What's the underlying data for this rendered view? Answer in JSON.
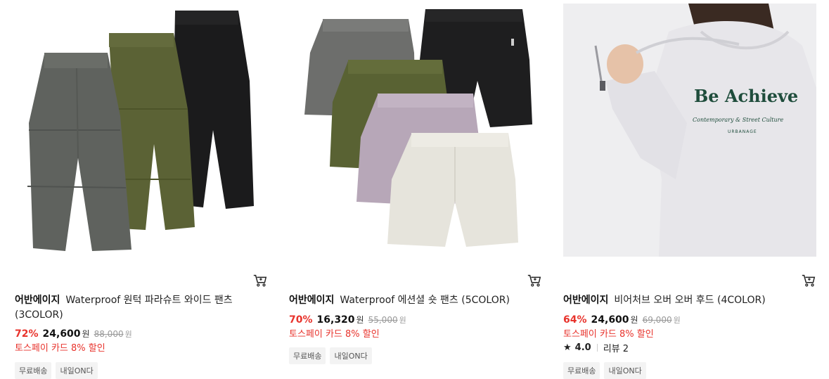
{
  "products": [
    {
      "brand": "어반에이지",
      "name": "Waterproof 원턱 파라슈트 와이드 팬츠 (3COLOR)",
      "discount": "72%",
      "price": "24,600",
      "currency": "원",
      "original_price": "88,000",
      "original_currency": "원",
      "promo": "토스페이 카드 8% 할인",
      "tags": [
        "무료배송",
        "내일ON다"
      ]
    },
    {
      "brand": "어반에이지",
      "name": "Waterproof 에션셜 숏 팬츠 (5COLOR)",
      "discount": "70%",
      "price": "16,320",
      "currency": "원",
      "original_price": "55,000",
      "original_currency": "원",
      "promo": "토스페이 카드 8% 할인",
      "tags": [
        "무료배송",
        "내일ON다"
      ]
    },
    {
      "brand": "어반에이지",
      "name": "비어처브 오버 오버 후드 (4COLOR)",
      "discount": "64%",
      "price": "24,600",
      "currency": "원",
      "original_price": "69,000",
      "original_currency": "원",
      "promo": "토스페이 카드 8% 할인",
      "rating": "4.0",
      "reviews": "리뷰 2",
      "tags": [
        "무료배송",
        "내일ON다"
      ],
      "print": {
        "headline": "Be Achieve",
        "script": "Contemporary & Street Culture",
        "logo": "URBANAGE"
      }
    }
  ],
  "colors": {
    "discount": "#e8332c",
    "pants_gray": "#5f625e",
    "pants_olive": "#5b6235",
    "pants_black": "#1b1b1c",
    "shorts_lilac": "#b7a7b8",
    "shorts_cream": "#e6e4dc",
    "hoodie": "#e7e6ea",
    "print_green": "#1f4d3c"
  }
}
